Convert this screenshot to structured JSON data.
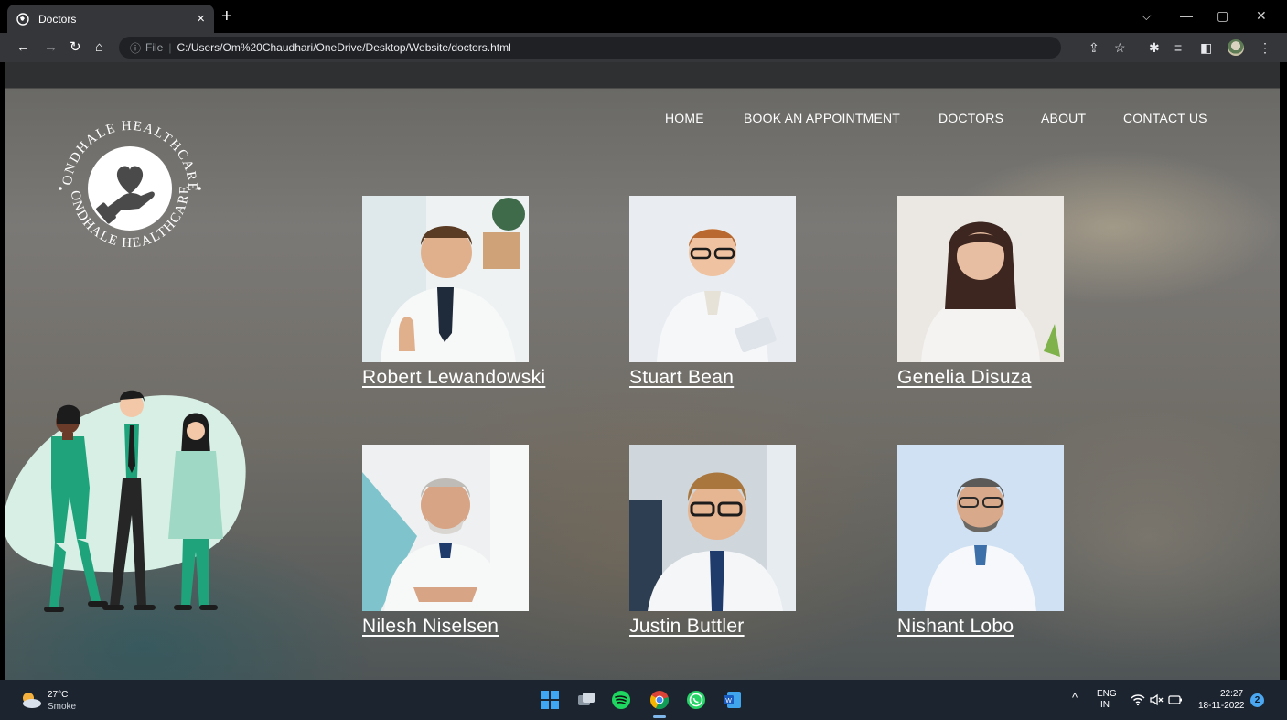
{
  "browser": {
    "tab_title": "Doctors",
    "tab_close": "×",
    "new_tab": "+",
    "url_scheme": "File",
    "url_separator": "|",
    "url": "C:/Users/Om%20Chaudhari/OneDrive/Desktop/Website/doctors.html",
    "window_controls": {
      "dropdown": "⌵",
      "minimize": "—",
      "restore": "▢",
      "close": "✕"
    },
    "nav": {
      "back": "←",
      "forward": "→",
      "reload": "↻",
      "home": "⌂"
    },
    "omnibox_info_icon": "ⓘ",
    "toolbar_icons": {
      "share": "⇪",
      "bookmark": "☆",
      "extensions": "✱",
      "reading_list": "≡",
      "side_panel": "◧",
      "menu": "⋮"
    }
  },
  "site": {
    "logo_text": "JONDHALE HEALTHCARE",
    "nav": [
      {
        "label": "HOME"
      },
      {
        "label": "BOOK AN APPOINTMENT"
      },
      {
        "label": "DOCTORS"
      },
      {
        "label": "ABOUT"
      },
      {
        "label": "CONTACT US"
      }
    ],
    "doctors": [
      {
        "name": "Robert Lewandowski"
      },
      {
        "name": "Stuart Bean"
      },
      {
        "name": "Genelia Disuza"
      },
      {
        "name": "Nilesh Niselsen"
      },
      {
        "name": "Justin Buttler"
      },
      {
        "name": "Nishant Lobo"
      }
    ]
  },
  "taskbar": {
    "weather_temp": "27°C",
    "weather_desc": "Smoke",
    "lang_top": "ENG",
    "lang_bottom": "IN",
    "time": "22:27",
    "date": "18-11-2022",
    "notification_count": "2",
    "tray_chevron": "^"
  },
  "colors": {
    "accent_green": "#1ea37a",
    "mint": "#cfe9df",
    "taskbar_bg": "#1c2430",
    "chrome_toolbar": "#35363a"
  }
}
